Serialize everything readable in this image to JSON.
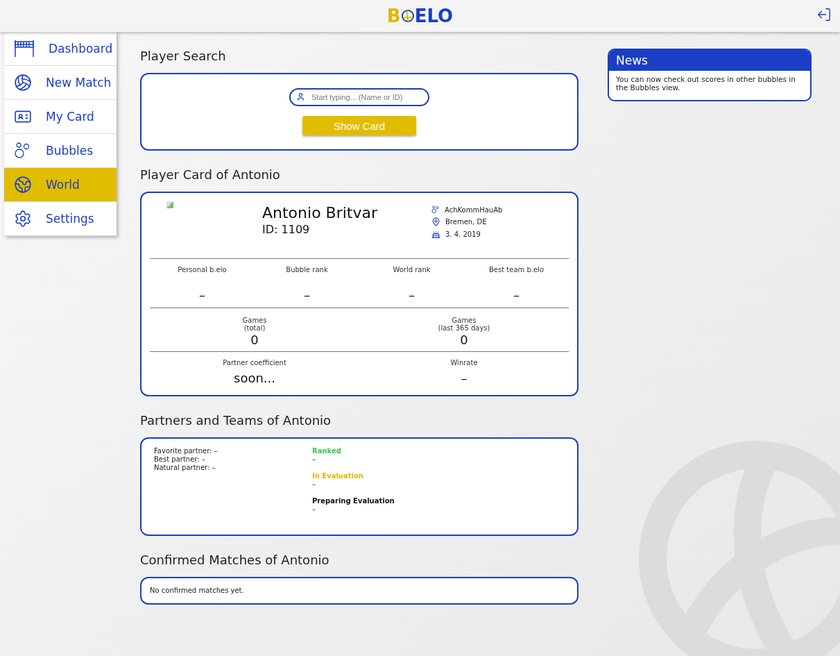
{
  "header": {
    "logo": {
      "first": "B",
      "rest": "ELO"
    }
  },
  "sidebar": {
    "items": [
      {
        "label": "Dashboard",
        "selected": false
      },
      {
        "label": "New Match",
        "selected": false
      },
      {
        "label": "My Card",
        "selected": false
      },
      {
        "label": "Bubbles",
        "selected": false
      },
      {
        "label": "World",
        "selected": true
      },
      {
        "label": "Settings",
        "selected": false
      }
    ]
  },
  "player_search": {
    "title": "Player Search",
    "placeholder": "Start typing... (Name or ID)",
    "button": "Show Card"
  },
  "player_card": {
    "title": "Player Card of Antonio",
    "name": "Antonio Britvar",
    "id": "ID: 1109",
    "details": [
      "AchKommHauAb",
      "Bremen, DE",
      "3. 4. 2019"
    ],
    "stats_row_1": [
      {
        "label": "Personal b.elo",
        "value": "–"
      },
      {
        "label": "Bubble rank",
        "value": "–"
      },
      {
        "label": "World rank",
        "value": "–"
      },
      {
        "label": "Best team b.elo",
        "value": "–"
      }
    ],
    "stats_row_2": [
      {
        "label": "Games",
        "sublabel": "(total)",
        "value": "0"
      },
      {
        "label": "Games",
        "sublabel": "(last 365 days)",
        "value": "0"
      }
    ],
    "stats_row_3": [
      {
        "label": "Partner coefficient",
        "value": "soon..."
      },
      {
        "label": "Winrate",
        "value": "–"
      }
    ]
  },
  "partners": {
    "title": "Partners and Teams of Antonio",
    "partner_lines": [
      "Favorite partner: –",
      "Best partner: –",
      "Natural partner: –"
    ],
    "team_groups": [
      {
        "heading": "Ranked",
        "color": "#33c94a",
        "value": "–"
      },
      {
        "heading": "In Evaluation",
        "color": "#e0b800",
        "value": "–"
      },
      {
        "heading": "Preparing Evaluation",
        "color": "#111111",
        "value": "–"
      }
    ]
  },
  "matches": {
    "title": "Confirmed Matches of Antonio",
    "message": "No confirmed matches yet."
  },
  "news": {
    "title": "News",
    "text": "You can now check out scores in other bubbles in the Bubbles view."
  }
}
